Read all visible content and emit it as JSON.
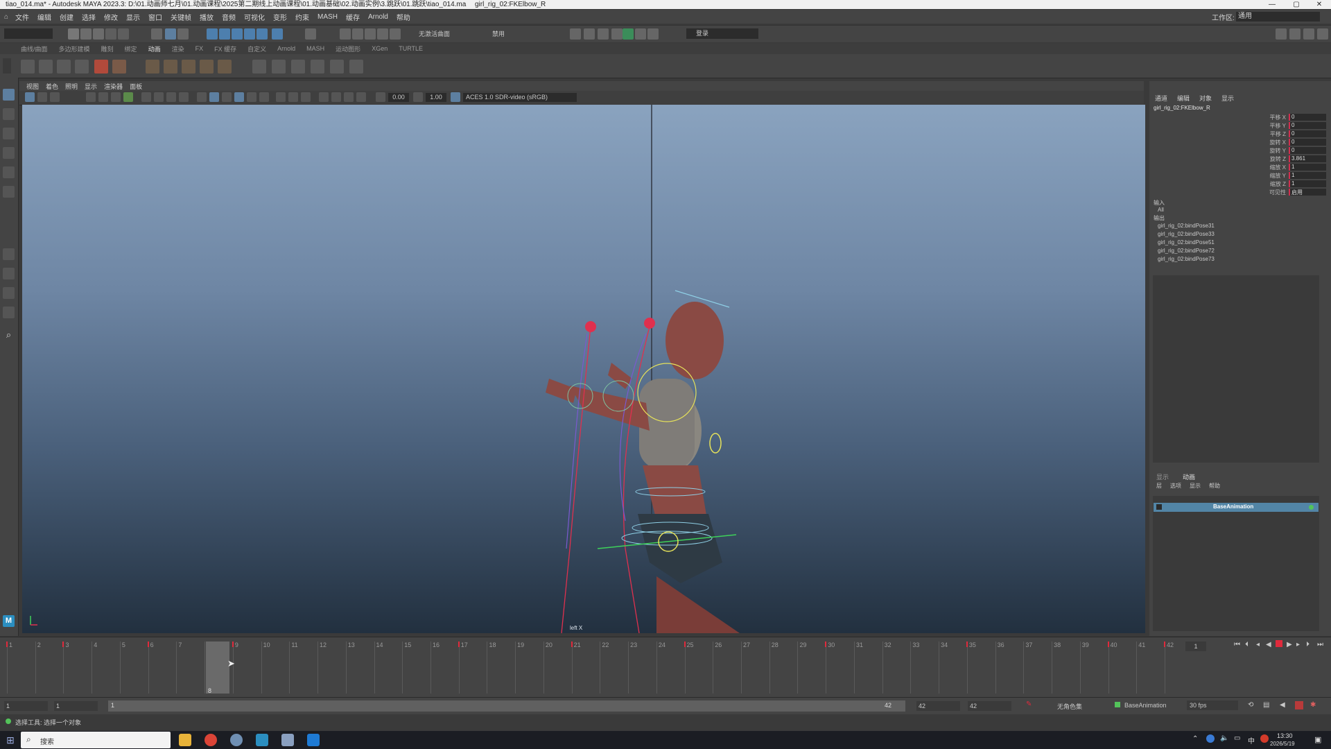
{
  "titlebar": {
    "title": "tiao_014.ma* - Autodesk MAYA 2023.3: D:\\01.动画师七月\\01.动画课程\\2025第二期线上动画课程\\01.动画基础\\02.动画实例\\3.跳跃\\01.跳跃\\tiao_014.ma",
    "object": "girl_rig_02:FKElbow_R"
  },
  "menubar": [
    "文件",
    "编辑",
    "创建",
    "选择",
    "修改",
    "显示",
    "窗口",
    "关键帧",
    "播放",
    "音频",
    "可视化",
    "变形",
    "约束",
    "MASH",
    "缓存",
    "Arnold",
    "帮助"
  ],
  "status": {
    "workspace_label": "工作区:",
    "workspace_value": "通用",
    "camera_value": "无激活曲面",
    "fps_value": "禁用",
    "login": "登录"
  },
  "shelf_tabs": [
    "曲线/曲面",
    "多边形建模",
    "雕刻",
    "绑定",
    "动画",
    "渲染",
    "FX",
    "FX 缓存",
    "自定义",
    "Arnold",
    "MASH",
    "运动图形",
    "XGen",
    "TURTLE"
  ],
  "shelf_active_tab": "动画",
  "viewport": {
    "menu": [
      "视图",
      "着色",
      "照明",
      "显示",
      "渲染器",
      "面板"
    ],
    "exposure": "0.00",
    "gamma": "1.00",
    "color_space": "ACES 1.0 SDR-video (sRGB)",
    "camera_label": "left X"
  },
  "channel_box": {
    "tabs": [
      "通道",
      "编辑",
      "对象",
      "显示"
    ],
    "object_name": "girl_rig_02:FKElbow_R",
    "attributes": [
      {
        "label": "平移 X",
        "value": "0"
      },
      {
        "label": "平移 Y",
        "value": "0"
      },
      {
        "label": "平移 Z",
        "value": "0"
      },
      {
        "label": "旋转 X",
        "value": "0"
      },
      {
        "label": "旋转 Y",
        "value": "0"
      },
      {
        "label": "旋转 Z",
        "value": "3.861"
      },
      {
        "label": "缩放 X",
        "value": "1"
      },
      {
        "label": "缩放 Y",
        "value": "1"
      },
      {
        "label": "缩放 Z",
        "value": "1"
      },
      {
        "label": "可见性",
        "value": "启用"
      }
    ],
    "inputs_label": "输入",
    "inputs_all": "All",
    "outputs_label": "输出",
    "outputs": [
      "girl_rig_02:bindPose31",
      "girl_rig_02:bindPose33",
      "girl_rig_02:bindPose51",
      "girl_rig_02:bindPose72",
      "girl_rig_02:bindPose73"
    ]
  },
  "layer_editor": {
    "tabs": [
      "显示",
      "动画"
    ],
    "menu": [
      "层",
      "选项",
      "显示",
      "帮助"
    ],
    "layer_name": "BaseAnimation"
  },
  "timeline": {
    "ticks": [
      "1",
      "2",
      "3",
      "4",
      "5",
      "6",
      "7",
      "8",
      "9",
      "10",
      "11",
      "12",
      "13",
      "14",
      "15",
      "16",
      "17",
      "18",
      "19",
      "20",
      "21",
      "22",
      "23",
      "24",
      "25",
      "26",
      "27",
      "28",
      "29",
      "30",
      "31",
      "32",
      "33",
      "34",
      "35",
      "36",
      "37",
      "38",
      "39",
      "40",
      "41",
      "42"
    ],
    "current_frame": "8",
    "key_frames": [
      1,
      3,
      6,
      9,
      17,
      21,
      25,
      30,
      35,
      40,
      42
    ],
    "current_frame_field": "1"
  },
  "range": {
    "start": "1",
    "playback_start": "1",
    "slider_start": "1",
    "slider_end": "42",
    "playback_end": "42",
    "end": "42",
    "char_set": "无角色集",
    "anim_layer": "BaseAnimation",
    "fps": "30 fps"
  },
  "helpline": {
    "text": "选择工具: 选择一个对象"
  },
  "taskbar": {
    "search": "搜索",
    "time": "13:30",
    "date": "2026/5/19",
    "ime": "中"
  },
  "colors": {
    "accent_key": "#e02a3c",
    "layer_highlight": "#5285a6",
    "rig_red": "#e0304e",
    "rig_yellow": "#e6e25a"
  }
}
